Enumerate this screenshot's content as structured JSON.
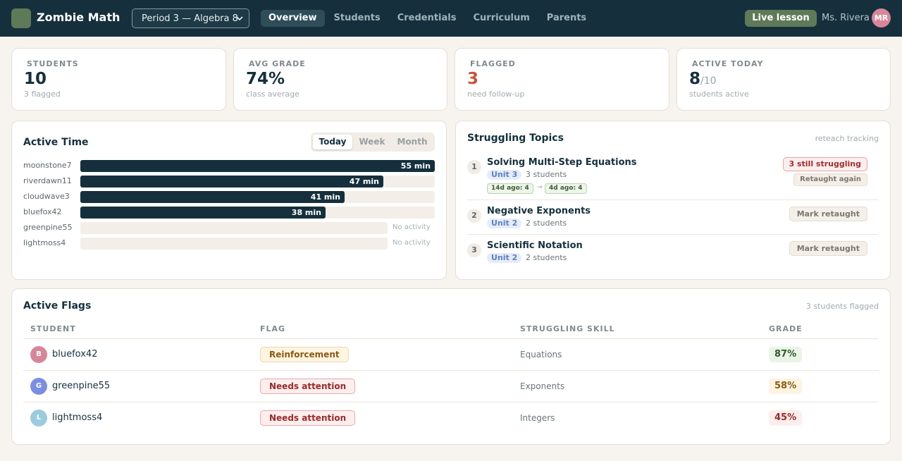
{
  "app": {
    "name": "Zombie Math"
  },
  "class_selector": {
    "value": "Period 3 — Algebra 8"
  },
  "nav": [
    "Overview",
    "Students",
    "Credentials",
    "Curriculum",
    "Parents"
  ],
  "live_button": "Live lesson",
  "teacher": {
    "name": "Ms. Rivera",
    "initials": "MR"
  },
  "stats": [
    {
      "label": "STUDENTS",
      "value": "10",
      "denom": "",
      "sub": "3 flagged",
      "color": "#15303c"
    },
    {
      "label": "AVG GRADE",
      "value": "74%",
      "denom": "",
      "sub": "class average",
      "color": "#15303c"
    },
    {
      "label": "FLAGGED",
      "value": "3",
      "denom": "",
      "sub": "need follow-up",
      "color": "#c5553a"
    },
    {
      "label": "ACTIVE TODAY",
      "value": "8",
      "denom": "/10",
      "sub": "students active",
      "color": "#15303c"
    }
  ],
  "active_time": {
    "title": "Active Time",
    "ranges": [
      "Today",
      "Week",
      "Month"
    ],
    "selected_range": "Today",
    "no_activity_label": "No activity",
    "rows": [
      {
        "name": "moonstone7",
        "minutes": 55,
        "label": "55 min"
      },
      {
        "name": "riverdawn11",
        "minutes": 47,
        "label": "47 min"
      },
      {
        "name": "cloudwave3",
        "minutes": 41,
        "label": "41 min"
      },
      {
        "name": "bluefox42",
        "minutes": 38,
        "label": "38 min"
      },
      {
        "name": "greenpine55",
        "minutes": 0,
        "label": ""
      },
      {
        "name": "lightmoss4",
        "minutes": 0,
        "label": ""
      }
    ]
  },
  "struggling": {
    "title": "Struggling Topics",
    "meta": "reteach tracking",
    "topics": [
      {
        "num": "1",
        "title": "Solving Multi-Step Equations",
        "unit": "Unit 3",
        "count": "3 students",
        "history": [
          "14d ago: 4",
          "→",
          "4d ago: 4"
        ],
        "status": "3 still struggling",
        "action": "Retaught again"
      },
      {
        "num": "2",
        "title": "Negative Exponents",
        "unit": "Unit 2",
        "count": "2 students",
        "action": "Mark retaught"
      },
      {
        "num": "3",
        "title": "Scientific Notation",
        "unit": "Unit 2",
        "count": "2 students",
        "action": "Mark retaught"
      }
    ]
  },
  "flags": {
    "title": "Active Flags",
    "meta": "3 students flagged",
    "columns": [
      "STUDENT",
      "FLAG",
      "STRUGGLING SKILL",
      "GRADE"
    ],
    "rows": [
      {
        "initial": "B",
        "avatar_color": "#d7869a",
        "student": "bluefox42",
        "flag": "Reinforcement",
        "flag_type": "reinf",
        "skill": "Equations",
        "grade": "87%",
        "grade_bg": "#e9f4e6",
        "grade_fg": "#2f5a2a"
      },
      {
        "initial": "G",
        "avatar_color": "#7b8fe0",
        "student": "greenpine55",
        "flag": "Needs attention",
        "flag_type": "needs",
        "skill": "Exponents",
        "grade": "58%",
        "grade_bg": "#fdf3e0",
        "grade_fg": "#8a5a12"
      },
      {
        "initial": "L",
        "avatar_color": "#9ccbe0",
        "student": "lightmoss4",
        "flag": "Needs attention",
        "flag_type": "needs",
        "skill": "Integers",
        "grade": "45%",
        "grade_bg": "#fdeeee",
        "grade_fg": "#962b2b"
      }
    ]
  }
}
